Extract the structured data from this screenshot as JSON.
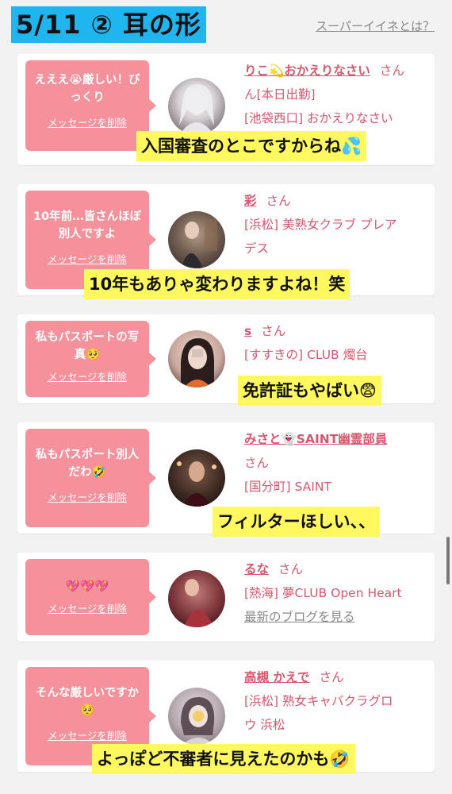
{
  "header": {
    "title": "5/11 ② 耳の形",
    "link": "スーパーイイネとは？"
  },
  "cards": [
    {
      "message": "えええ😭厳しい！びっくり",
      "delete_label": "メッセージを削除",
      "name": "りこ💫おかえりなさい",
      "honorific": "さん",
      "lines": [
        "ん[本日出勤]",
        "[池袋西口] おかえりなさい"
      ],
      "caption": "入国審査のとこですからね💦"
    },
    {
      "message": "10年前…皆さんほぼ別人ですよ",
      "delete_label": "メッセージを削除",
      "name": "彩",
      "honorific": "さん",
      "lines": [
        "[浜松] 美熟女クラブ プレア",
        "デス"
      ],
      "caption": "10年もありゃ変わりますよね！笑"
    },
    {
      "message": "私もパスポートの写真🥺",
      "delete_label": "メッセージを削除",
      "name": "s",
      "honorific": "さん",
      "lines": [
        "[すすきの] CLUB 燭台"
      ],
      "caption": "免許証もやばい😨"
    },
    {
      "message": "私もパスポート別人だわ🤣",
      "delete_label": "メッセージを削除",
      "name": "みさと👻SAINT幽霊部員",
      "honorific": "さん",
      "lines": [
        "さん",
        "[国分町] SAINT"
      ],
      "caption": "フィルターほしい、、"
    },
    {
      "message": "💖💖💖",
      "delete_label": "メッセージを削除",
      "name": "るな",
      "honorific": "さん",
      "lines": [
        "[熱海] 夢CLUB Open Heart"
      ],
      "blog": "最新のブログを見る",
      "caption": ""
    },
    {
      "message": "そんな厳しいですか🥺",
      "delete_label": "メッセージを削除",
      "name": "高槻 かえで",
      "honorific": "さん",
      "lines": [
        "[浜松] 熟女キャバクラグロ",
        "ウ 浜松"
      ],
      "caption": "よっぽど不審者に見えたのかも🤣"
    }
  ],
  "colors": {
    "accent_pink": "#f4919b",
    "link_pink": "#d9576e",
    "title_bg": "#1fb6f0",
    "caption_bg": "#fff85e"
  }
}
